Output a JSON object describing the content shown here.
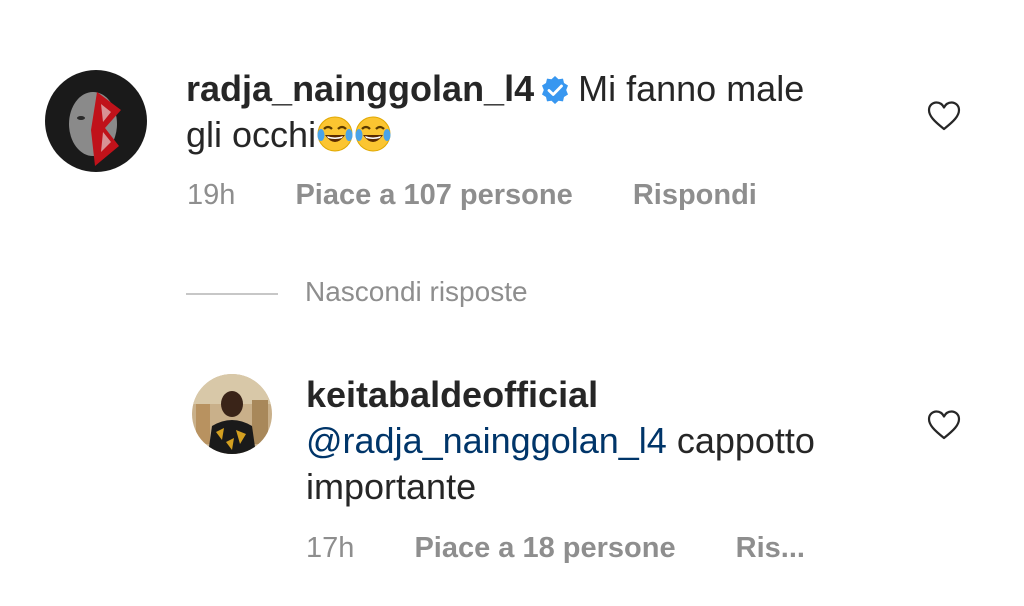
{
  "comment": {
    "username": "radja_nainggolan_l4",
    "verified": true,
    "text_line1": "Mi fanno male",
    "text_line2": "gli occhi",
    "emoji": [
      "face-with-tears-of-joy",
      "face-with-tears-of-joy"
    ],
    "time": "19h",
    "likes": "Piace a 107 persone",
    "reply": "Rispondi"
  },
  "toggle": {
    "label": "Nascondi risposte"
  },
  "reply": {
    "username": "keitabaldeofficial",
    "mention": "@radja_nainggolan_l4",
    "text_line1": "cappotto",
    "text_line2": "importante",
    "time": "17h",
    "likes": "Piace a 18 persone",
    "reply": "Ris..."
  },
  "colors": {
    "text": "#262626",
    "secondary": "#8e8e8e",
    "mention": "#003569",
    "verified": "#3897f0"
  }
}
